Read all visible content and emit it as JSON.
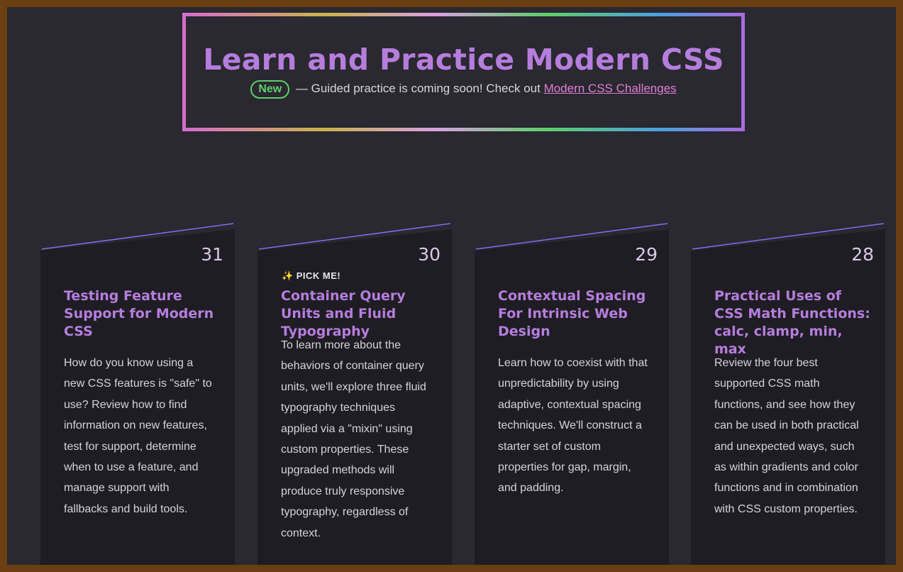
{
  "hero": {
    "title": "Learn and Practice Modern CSS",
    "badge": "New",
    "subtitle": " — Guided practice is coming soon! Check out ",
    "link": "Modern CSS Challenges"
  },
  "cards": [
    {
      "number": "31",
      "pick": "",
      "title": "Testing Feature Support for Modern CSS",
      "description": "How do you know using a new CSS features is \"safe\" to use? Review how to find information on new features, test for support, determine when to use a feature, and manage support with fallbacks and build tools."
    },
    {
      "number": "30",
      "pick": "PICK ME!",
      "title": "Container Query Units and Fluid Typography",
      "description": "To learn more about the behaviors of container query units, we'll explore three fluid typography techniques applied via a \"mixin\" using custom properties. These upgraded methods will produce truly responsive typography, regardless of context."
    },
    {
      "number": "29",
      "pick": "",
      "title": "Contextual Spacing For Intrinsic Web Design",
      "description": "Learn how to coexist with that unpredictability by using adaptive, contextual spacing techniques. We'll construct a starter set of custom properties for gap, margin, and padding."
    },
    {
      "number": "28",
      "pick": "",
      "title": "Practical Uses of CSS Math Functions: calc, clamp, min, max",
      "description": "Review the four best supported CSS math functions, and see how they can be used in both practical and unexpected ways, such as within gradients and color functions and in combination with CSS custom properties."
    }
  ],
  "colors": {
    "page_bg": "#2a2830",
    "frame": "#6b3f12",
    "card_bg": "#1f1d24",
    "accent": "#b57edc",
    "badge": "#5ccf6a",
    "link": "#e07fd6"
  },
  "icons": {
    "pick": "sparkles-icon"
  }
}
